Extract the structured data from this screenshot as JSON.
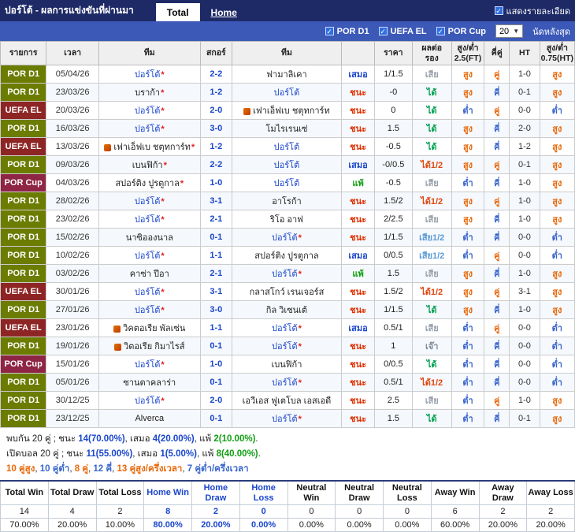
{
  "colors": {
    "topbar_bg": "#1e2a66",
    "filterbar_bg": "#3c59b8",
    "accent_blue": "#1a46cc",
    "win_red": "#e03000",
    "draw_blue": "#1a46cc",
    "loss_green": "#12a012",
    "gain_green": "#00a050",
    "gain_half_orange": "#e04810",
    "lose_gray": "#98a0a8",
    "lose_half_blue": "#5b9bd5",
    "push_gray": "#7f8c9a",
    "over_orange": "#e8680a",
    "under_blue": "#3a66cc",
    "league_d1": "#6b7c00",
    "league_el": "#8e2525",
    "league_cup": "#8e2545",
    "header_bg": "#efefef",
    "row_alt": "#f5f8fc",
    "border": "#cccccc",
    "star_red": "#e02020",
    "check_blue": "#2f6fe0"
  },
  "header_bar": {
    "title": "ปอร์โต้ - ผลการแข่งขันที่ผ่านมา",
    "tabs": [
      {
        "label": "Total",
        "active": true
      },
      {
        "label": "Home",
        "active": false
      }
    ],
    "details_checkbox_label": "แสดงรายละเอียด",
    "details_checked": true
  },
  "filter_bar": {
    "leagues": [
      {
        "label": "POR D1",
        "checked": true
      },
      {
        "label": "UEFA EL",
        "checked": true
      },
      {
        "label": "POR Cup",
        "checked": true
      }
    ],
    "count_select_value": "20",
    "count_suffix_label": "นัดหลังสุด"
  },
  "table": {
    "columns": [
      "รายการ",
      "เวลา",
      "ทีม",
      "สกอร์",
      "ทีม",
      "",
      "ราคา",
      "ผลต่อ\nรอง",
      "สูง/ต่ำ\n2.5(FT)",
      "คี่คู่",
      "HT",
      "สูง/ต่ำ\n0.75(HT)"
    ],
    "rows": [
      {
        "league": "POR D1",
        "date": "05/04/26",
        "home": {
          "name": "ปอร์โต้",
          "porto": true,
          "star": true
        },
        "score": "2-2",
        "away": {
          "name": "ฟามาลิเคา"
        },
        "result": "เสมอ",
        "price": "1/1.5",
        "handicap": "เสีย",
        "ou_ft": "สูง",
        "odd_even": "คู่",
        "ht": "1-0",
        "ou_ht": "สูง"
      },
      {
        "league": "POR D1",
        "date": "23/03/26",
        "home": {
          "name": "บราก้า",
          "star": true
        },
        "score": "1-2",
        "away": {
          "name": "ปอร์โต้",
          "porto": true
        },
        "result": "ชนะ",
        "price": "-0",
        "handicap": "ได้",
        "ou_ft": "สูง",
        "odd_even": "คี่",
        "ht": "0-1",
        "ou_ht": "สูง"
      },
      {
        "league": "UEFA EL",
        "date": "20/03/26",
        "home": {
          "name": "ปอร์โต้",
          "porto": true,
          "star": true
        },
        "score": "2-0",
        "away": {
          "name": "เฟาเอ็ฟเบ ชตุทการ์ท",
          "icon": true
        },
        "result": "ชนะ",
        "price": "0",
        "handicap": "ได้",
        "ou_ft": "ต่ำ",
        "odd_even": "คู่",
        "ht": "0-0",
        "ou_ht": "ต่ำ"
      },
      {
        "league": "POR D1",
        "date": "16/03/26",
        "home": {
          "name": "ปอร์โต้",
          "porto": true,
          "star": true
        },
        "score": "3-0",
        "away": {
          "name": "โมไรเรนเซ่"
        },
        "result": "ชนะ",
        "price": "1.5",
        "handicap": "ได้",
        "ou_ft": "สูง",
        "odd_even": "คี่",
        "ht": "2-0",
        "ou_ht": "สูง"
      },
      {
        "league": "UEFA EL",
        "date": "13/03/26",
        "home": {
          "name": "เฟาเอ็ฟเบ ชตุทการ์ท",
          "icon": true,
          "star": true
        },
        "score": "1-2",
        "away": {
          "name": "ปอร์โต้",
          "porto": true
        },
        "result": "ชนะ",
        "price": "-0.5",
        "handicap": "ได้",
        "ou_ft": "สูง",
        "odd_even": "คี่",
        "ht": "1-2",
        "ou_ht": "สูง"
      },
      {
        "league": "POR D1",
        "date": "09/03/26",
        "home": {
          "name": "เบนฟิก้า",
          "star": true
        },
        "score": "2-2",
        "away": {
          "name": "ปอร์โต้",
          "porto": true
        },
        "result": "เสมอ",
        "price": "-0/0.5",
        "handicap": "ได้1/2",
        "ou_ft": "สูง",
        "odd_even": "คู่",
        "ht": "0-1",
        "ou_ht": "สูง"
      },
      {
        "league": "POR Cup",
        "date": "04/03/26",
        "home": {
          "name": "สปอร์ติง ปูรตูกาล",
          "star": true
        },
        "score": "1-0",
        "away": {
          "name": "ปอร์โต้",
          "porto": true
        },
        "result": "แพ้",
        "price": "-0.5",
        "handicap": "เสีย",
        "ou_ft": "ต่ำ",
        "odd_even": "คี่",
        "ht": "1-0",
        "ou_ht": "สูง"
      },
      {
        "league": "POR D1",
        "date": "28/02/26",
        "home": {
          "name": "ปอร์โต้",
          "porto": true,
          "star": true
        },
        "score": "3-1",
        "away": {
          "name": "อาโรก้า"
        },
        "result": "ชนะ",
        "price": "1.5/2",
        "handicap": "ได้1/2",
        "ou_ft": "สูง",
        "odd_even": "คู่",
        "ht": "1-0",
        "ou_ht": "สูง"
      },
      {
        "league": "POR D1",
        "date": "23/02/26",
        "home": {
          "name": "ปอร์โต้",
          "porto": true,
          "star": true
        },
        "score": "2-1",
        "away": {
          "name": "ริโอ อาฟ"
        },
        "result": "ชนะ",
        "price": "2/2.5",
        "handicap": "เสีย",
        "ou_ft": "สูง",
        "odd_even": "คี่",
        "ht": "1-0",
        "ou_ht": "สูง"
      },
      {
        "league": "POR D1",
        "date": "15/02/26",
        "home": {
          "name": "นาซิอองนาล"
        },
        "score": "0-1",
        "away": {
          "name": "ปอร์โต้",
          "porto": true,
          "star": true
        },
        "result": "ชนะ",
        "price": "1/1.5",
        "handicap": "เสีย1/2",
        "ou_ft": "ต่ำ",
        "odd_even": "คี่",
        "ht": "0-0",
        "ou_ht": "ต่ำ"
      },
      {
        "league": "POR D1",
        "date": "10/02/26",
        "home": {
          "name": "ปอร์โต้",
          "porto": true,
          "star": true
        },
        "score": "1-1",
        "away": {
          "name": "สปอร์ติง ปูรตูกาล"
        },
        "result": "เสมอ",
        "price": "0/0.5",
        "handicap": "เสีย1/2",
        "ou_ft": "ต่ำ",
        "odd_even": "คู่",
        "ht": "0-0",
        "ou_ht": "ต่ำ"
      },
      {
        "league": "POR D1",
        "date": "03/02/26",
        "home": {
          "name": "คาซ่า ปีอา"
        },
        "score": "2-1",
        "away": {
          "name": "ปอร์โต้",
          "porto": true,
          "star": true
        },
        "result": "แพ้",
        "price": "1.5",
        "handicap": "เสีย",
        "ou_ft": "สูง",
        "odd_even": "คี่",
        "ht": "1-0",
        "ou_ht": "สูง"
      },
      {
        "league": "UEFA EL",
        "date": "30/01/26",
        "home": {
          "name": "ปอร์โต้",
          "porto": true,
          "star": true
        },
        "score": "3-1",
        "away": {
          "name": "กลาสโกว์ เรนเจอร์ส"
        },
        "result": "ชนะ",
        "price": "1.5/2",
        "handicap": "ได้1/2",
        "ou_ft": "สูง",
        "odd_even": "คู่",
        "ht": "3-1",
        "ou_ht": "สูง"
      },
      {
        "league": "POR D1",
        "date": "27/01/26",
        "home": {
          "name": "ปอร์โต้",
          "porto": true,
          "star": true
        },
        "score": "3-0",
        "away": {
          "name": "กิล วิเซนเต้"
        },
        "result": "ชนะ",
        "price": "1/1.5",
        "handicap": "ได้",
        "ou_ft": "สูง",
        "odd_even": "คี่",
        "ht": "1-0",
        "ou_ht": "สูง"
      },
      {
        "league": "UEFA EL",
        "date": "23/01/26",
        "home": {
          "name": "วิคตอเรีย พัลเซ่น",
          "icon": true
        },
        "score": "1-1",
        "away": {
          "name": "ปอร์โต้",
          "porto": true,
          "star": true
        },
        "result": "เสมอ",
        "price": "0.5/1",
        "handicap": "เสีย",
        "ou_ft": "ต่ำ",
        "odd_even": "คู่",
        "ht": "0-0",
        "ou_ht": "ต่ำ"
      },
      {
        "league": "POR D1",
        "date": "19/01/26",
        "home": {
          "name": "วิตอเรีย กิมาไรส์",
          "icon": true
        },
        "score": "0-1",
        "away": {
          "name": "ปอร์โต้",
          "porto": true,
          "star": true
        },
        "result": "ชนะ",
        "price": "1",
        "handicap": "เจ๊า",
        "ou_ft": "ต่ำ",
        "odd_even": "คี่",
        "ht": "0-0",
        "ou_ht": "ต่ำ"
      },
      {
        "league": "POR Cup",
        "date": "15/01/26",
        "home": {
          "name": "ปอร์โต้",
          "porto": true,
          "star": true
        },
        "score": "1-0",
        "away": {
          "name": "เบนฟิก้า"
        },
        "result": "ชนะ",
        "price": "0/0.5",
        "handicap": "ได้",
        "ou_ft": "ต่ำ",
        "odd_even": "คี่",
        "ht": "0-0",
        "ou_ht": "ต่ำ"
      },
      {
        "league": "POR D1",
        "date": "05/01/26",
        "home": {
          "name": "ซานตาคลาร่า"
        },
        "score": "0-1",
        "away": {
          "name": "ปอร์โต้",
          "porto": true,
          "star": true
        },
        "result": "ชนะ",
        "price": "0.5/1",
        "handicap": "ได้1/2",
        "ou_ft": "ต่ำ",
        "odd_even": "คี่",
        "ht": "0-0",
        "ou_ht": "ต่ำ"
      },
      {
        "league": "POR D1",
        "date": "30/12/25",
        "home": {
          "name": "ปอร์โต้",
          "porto": true,
          "star": true
        },
        "score": "2-0",
        "away": {
          "name": "เอวีเอส ฟูเตโบล เอสเอดี"
        },
        "result": "ชนะ",
        "price": "2.5",
        "handicap": "เสีย",
        "ou_ft": "ต่ำ",
        "odd_even": "คู่",
        "ht": "1-0",
        "ou_ht": "สูง"
      },
      {
        "league": "POR D1",
        "date": "23/12/25",
        "home": {
          "name": "Alverca"
        },
        "score": "0-1",
        "away": {
          "name": "ปอร์โต้",
          "porto": true,
          "star": true
        },
        "result": "ชนะ",
        "price": "1.5",
        "handicap": "ได้",
        "ou_ft": "ต่ำ",
        "odd_even": "คี่",
        "ht": "0-1",
        "ou_ht": "สูง"
      }
    ]
  },
  "summary": {
    "lines": [
      [
        {
          "text": "พบกัน 20 คู่ ; ชนะ ",
          "cls": "plain"
        },
        {
          "text": "14(70.00%)",
          "cls": "num-blue"
        },
        {
          "text": ", เสมอ ",
          "cls": "plain"
        },
        {
          "text": "4(20.00%)",
          "cls": "num-blue"
        },
        {
          "text": ", แพ้ ",
          "cls": "plain"
        },
        {
          "text": "2(10.00%)",
          "cls": "num-green"
        },
        {
          "text": ".",
          "cls": "plain"
        }
      ],
      [
        {
          "text": "เปิดบอล 20 คู่ ; ชนะ ",
          "cls": "plain"
        },
        {
          "text": "11(55.00%)",
          "cls": "num-blue"
        },
        {
          "text": ", เสมอ ",
          "cls": "plain"
        },
        {
          "text": "1(5.00%)",
          "cls": "num-blue"
        },
        {
          "text": ", แพ้ ",
          "cls": "plain"
        },
        {
          "text": "8(40.00%)",
          "cls": "num-green"
        },
        {
          "text": ".",
          "cls": "plain"
        }
      ],
      [
        {
          "text": "10 คู่สูง",
          "cls": "over"
        },
        {
          "text": ", ",
          "cls": "plain"
        },
        {
          "text": "10 คู่ต่ำ",
          "cls": "under"
        },
        {
          "text": ", ",
          "cls": "plain"
        },
        {
          "text": "8 คู่",
          "cls": "even"
        },
        {
          "text": ", ",
          "cls": "plain"
        },
        {
          "text": "12 คี่",
          "cls": "odd"
        },
        {
          "text": ", ",
          "cls": "plain"
        },
        {
          "text": "13 คู่สูง/ครึ่งเวลา",
          "cls": "over"
        },
        {
          "text": ", ",
          "cls": "plain"
        },
        {
          "text": "7 คู่ต่ำ/ครึ่งเวลา",
          "cls": "under"
        }
      ]
    ]
  },
  "totals": {
    "headers": [
      "Total Win",
      "Total Draw",
      "Total Loss",
      "Home Win",
      "Home Draw",
      "Home Loss",
      "Neutral Win",
      "Neutral Draw",
      "Neutral Loss",
      "Away Win",
      "Away Draw",
      "Away Loss"
    ],
    "counts": [
      "14",
      "4",
      "2",
      "8",
      "2",
      "0",
      "0",
      "0",
      "0",
      "6",
      "2",
      "2"
    ],
    "percents": [
      "70.00%",
      "20.00%",
      "10.00%",
      "80.00%",
      "20.00%",
      "0.00%",
      "0.00%",
      "0.00%",
      "0.00%",
      "60.00%",
      "20.00%",
      "20.00%"
    ],
    "highlight_cols": [
      3,
      4,
      5
    ]
  }
}
